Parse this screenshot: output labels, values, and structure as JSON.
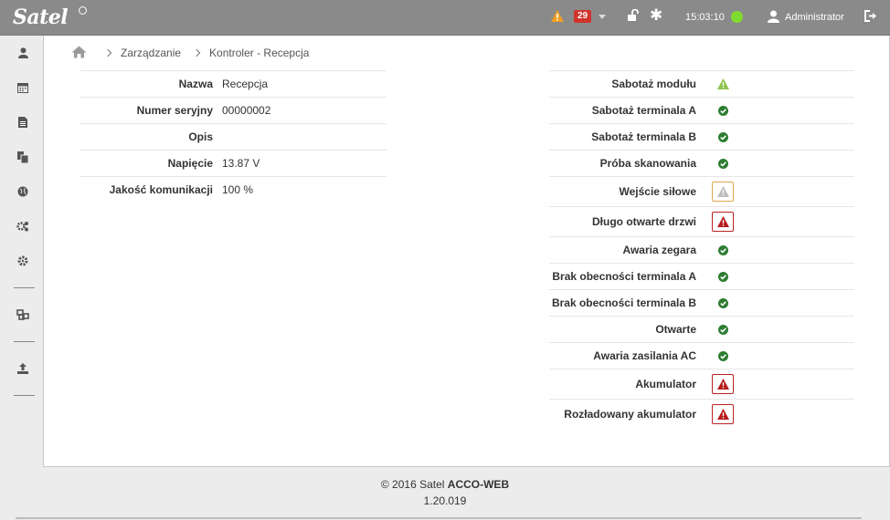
{
  "header": {
    "brand": "Satel",
    "alarm_count": "29",
    "time": "15:03:10",
    "user": "Administrator",
    "colors": {
      "bar": "#8a8a8a",
      "warning": "#f0a020",
      "badge": "#d0342c",
      "online": "#7fdc2e"
    }
  },
  "sidebar": {
    "items": [
      {
        "icon": "user-icon"
      },
      {
        "icon": "calendar-icon"
      },
      {
        "icon": "document-icon"
      },
      {
        "icon": "copy-icon"
      },
      {
        "icon": "globe-icon"
      },
      {
        "icon": "cogs-icon"
      },
      {
        "icon": "gear-icon"
      },
      {
        "icon": "network-icon"
      },
      {
        "icon": "upload-icon"
      }
    ]
  },
  "breadcrumb": {
    "home_icon": "home-icon",
    "items": [
      "Zarządzanie",
      "Kontroler - Recepcja"
    ]
  },
  "info": [
    {
      "label": "Nazwa",
      "value": "Recepcja"
    },
    {
      "label": "Numer seryjny",
      "value": "00000002"
    },
    {
      "label": "Opis",
      "value": ""
    },
    {
      "label": "Napięcie",
      "value": "13.87 V"
    },
    {
      "label": "Jakość komunikacji",
      "value": "100 %"
    }
  ],
  "statuses": [
    {
      "label": "Sabotaż modułu",
      "state": "warning-green"
    },
    {
      "label": "Sabotaż terminala A",
      "state": "ok"
    },
    {
      "label": "Sabotaż terminala B",
      "state": "ok"
    },
    {
      "label": "Próba skanowania",
      "state": "ok"
    },
    {
      "label": "Wejście siłowe",
      "state": "warning-grey"
    },
    {
      "label": "Długo otwarte drzwi",
      "state": "alarm"
    },
    {
      "label": "Awaria zegara",
      "state": "ok"
    },
    {
      "label": "Brak obecności terminala A",
      "state": "ok"
    },
    {
      "label": "Brak obecności terminala B",
      "state": "ok"
    },
    {
      "label": "Otwarte",
      "state": "ok"
    },
    {
      "label": "Awaria zasilania AC",
      "state": "ok"
    },
    {
      "label": "Akumulator",
      "state": "alarm"
    },
    {
      "label": "Rozładowany akumulator",
      "state": "alarm"
    }
  ],
  "footer": {
    "copyright": "© 2016 Satel",
    "product": "ACCO-WEB",
    "version": "1.20.019"
  }
}
